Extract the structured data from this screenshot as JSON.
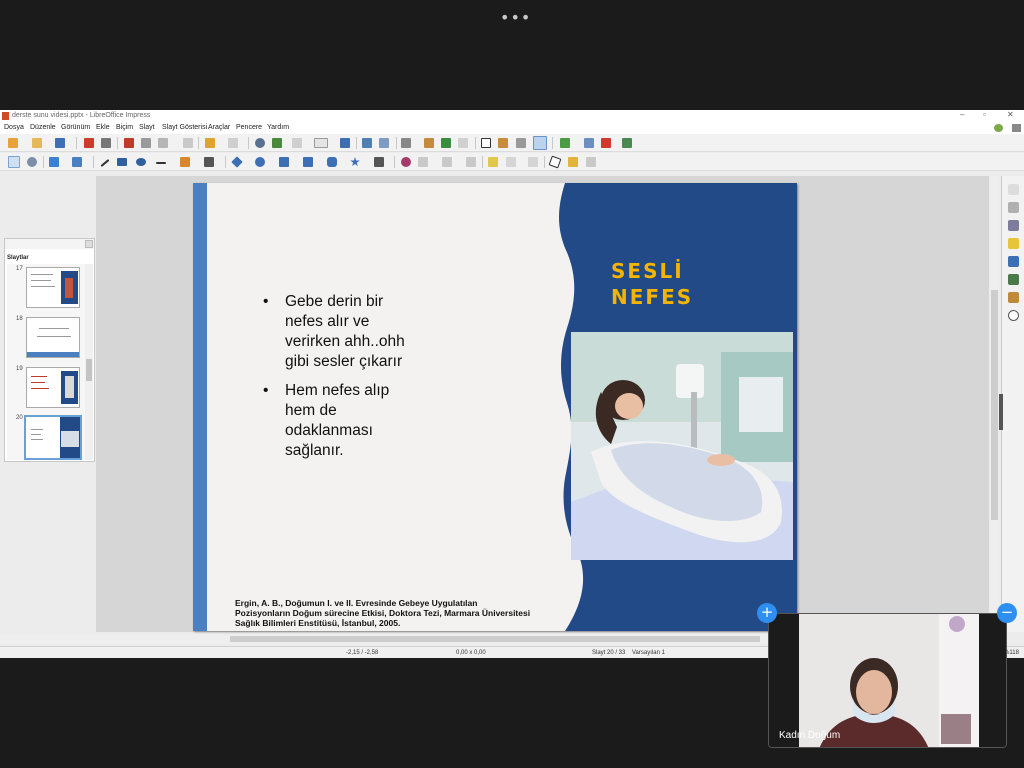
{
  "window": {
    "title": "derste sunu videsi.pptx - LibreOffice Impress",
    "controls": [
      "–",
      "▫",
      "✕"
    ]
  },
  "meeting": {
    "more_label": "•••",
    "participant_name": "Kadın Doğum",
    "add_label": "+",
    "minimize_label": "−"
  },
  "menu": {
    "items": [
      "Dosya",
      "Düzenle",
      "Görünüm",
      "Ekle",
      "Biçim",
      "Slayt",
      "Slayt Gösterisi",
      "Araçlar",
      "Pencere",
      "Yardım"
    ]
  },
  "slides_panel": {
    "title": "Slaytlar",
    "slide_numbers": [
      "17",
      "18",
      "19",
      "20"
    ]
  },
  "slide": {
    "title_line1": "SESLİ",
    "title_line2": "NEFES",
    "bullet_mark": "•",
    "bullet1": "Gebe derin bir nefes alır ve verirken ahh..ohh gibi sesler çıkarır",
    "bullet2": "Hem nefes alıp hem de odaklanması sağlanır.",
    "reference": "Ergin, A. B., Doğumun I. ve II. Evresinde Gebeye Uygulatılan Pozisyonların Doğum sürecine Etkisi, Doktora Tezi, Marmara Üniversitesi Sağlık Bilimleri Enstitüsü, İstanbul, 2005.",
    "colors": {
      "navy": "#214a87",
      "accent_bar": "#4a7fc1",
      "title": "#f4b400",
      "background": "#f4f2f1"
    }
  },
  "status": {
    "position": "-2,15 / -2,58",
    "size": "0,00 x 0,00",
    "slide_counter": "Slayt 20 / 33",
    "master": "Varsayılan 1",
    "zoom": "%118"
  }
}
